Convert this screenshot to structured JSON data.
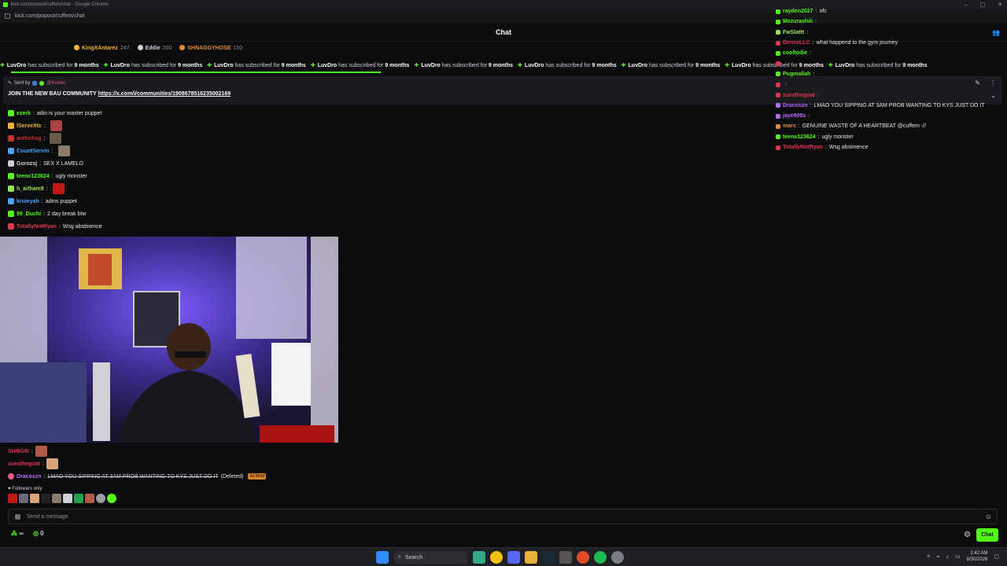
{
  "browser": {
    "title": "kick.com/popout/cuffem/chat - Google Chrome",
    "url": "kick.com/popout/cuffem/chat"
  },
  "header": {
    "title": "Chat"
  },
  "leaderboard": [
    {
      "name": "KingXAntarez",
      "value": "247",
      "color": "#f2b233"
    },
    {
      "name": "Eddie",
      "value": "200",
      "color": "#cfd1d6"
    },
    {
      "name": "SHNAGGYHOSE",
      "value": "150",
      "color": "#e28a3a"
    }
  ],
  "ticker": {
    "items": [
      {
        "user": "LuvDro",
        "text": "has subscribed for",
        "months": "9 months"
      },
      {
        "user": "LuvDro",
        "text": "has subscribed for",
        "months": "9 months"
      },
      {
        "user": "LuvDro",
        "text": "has subscribed for",
        "months": "9 months"
      },
      {
        "user": "LuvDro",
        "text": "has subscribed for",
        "months": "9 months"
      },
      {
        "user": "LuvDro",
        "text": "has subscribed for",
        "months": "9 months"
      },
      {
        "user": "LuvDro",
        "text": "has subscribed for",
        "months": "9 months"
      },
      {
        "user": "LuvDro",
        "text": "has subscribed for",
        "months": "9 months"
      },
      {
        "user": "LuvDro",
        "text": "has subscribed for",
        "months": "9 months"
      },
      {
        "user": "LuvDro",
        "text": "has subscribed for",
        "months": "9 months"
      }
    ]
  },
  "pinned": {
    "sent_by_label": "Sent by",
    "sender": "@Kickiet",
    "message": "JOIN THE NEW BAU COMMUNITY",
    "link": "https://x.com/i/communities/1908678516235002169"
  },
  "chat": [
    {
      "user": "ezerk",
      "color": "#53fc18",
      "text": "adin is your master puppet",
      "emote": ""
    },
    {
      "user": "lServeXtc",
      "color": "#f2b233",
      "text": "",
      "emote": "#a44"
    },
    {
      "user": "anthohsg",
      "color": "#c93030",
      "text": "",
      "emote": "#6a5a4a"
    },
    {
      "user": "CountServin",
      "color": "#4aa3ff",
      "text": "",
      "emote": "#8a7a6a"
    },
    {
      "user": "Gorozsj",
      "color": "#cfd1d6",
      "text": "SEX X LAMELO",
      "emote": ""
    },
    {
      "user": "teenx123624",
      "color": "#53fc18",
      "text": "ugly monster",
      "emote": ""
    },
    {
      "user": "h_aitham9",
      "color": "#9ce35a",
      "text": "",
      "emote": "#c21818"
    },
    {
      "user": "kruieyah",
      "color": "#4aa3ff",
      "text": "adins puppet",
      "emote": ""
    },
    {
      "user": "99_Duchi",
      "color": "#53fc18",
      "text": "2 day break btw",
      "emote": ""
    },
    {
      "user": "TotallyNotRyan",
      "color": "#e0364f",
      "text": "Wsg abstinence",
      "emote": ""
    }
  ],
  "chat_lower": [
    {
      "user": "SHI6G6I",
      "color": "#e0364f",
      "text": "",
      "emote": "#b05a4a"
    },
    {
      "user": "zuesthegoat",
      "color": "#e0364f",
      "text": "",
      "emote": "#d9a57a"
    },
    {
      "user": "Dracoszn",
      "color": "#b46cff",
      "text": "LMAO YOU SIPPING AT 3AM PROB WANTING TO KYS JUST DO IT",
      "deleted": "(Deleted)",
      "tag": "AI Mod"
    }
  ],
  "followers_only": "Followers only",
  "input": {
    "placeholder": "Send a message"
  },
  "bottom": {
    "count1": "∞",
    "count2": "0",
    "chat_button": "Chat"
  },
  "right_chat": [
    {
      "user": "rayden2027",
      "color": "#53fc18",
      "text": "ofc"
    },
    {
      "user": "Mezurashiii",
      "color": "#53fc18",
      "text": ""
    },
    {
      "user": "FwSlattt",
      "color": "#9ce35a",
      "text": ""
    },
    {
      "user": "DenzoLLC",
      "color": "#e0364f",
      "text": "what happend to the gym journey"
    },
    {
      "user": "cooltodie",
      "color": "#53fc18",
      "text": ""
    },
    {
      "user": "",
      "color": "#e0364f",
      "text": ""
    },
    {
      "user": "Pugmallah",
      "color": "#53fc18",
      "text": ""
    },
    {
      "user": "",
      "color": "#e0364f",
      "text": ""
    },
    {
      "user": "zuesthegoat",
      "color": "#e0364f",
      "text": ""
    },
    {
      "user": "Dracoszn",
      "color": "#b46cff",
      "text": "LMAO YOU SIPPING AT 3AM PROB WANTING TO KYS JUST DO IT"
    },
    {
      "user": "jaye808s",
      "color": "#b46cff",
      "text": ""
    },
    {
      "user": "marx",
      "color": "#e28a3a",
      "text": "GENUINE WASTE OF A HEARTBEAT @cuffem -//"
    },
    {
      "user": "teenx123624",
      "color": "#53fc18",
      "text": "ugly monster"
    },
    {
      "user": "TotallyNotRyan",
      "color": "#e0364f",
      "text": "Wsg abstinence"
    }
  ],
  "taskbar": {
    "search": "Search",
    "time": "2:42 AM",
    "date": "8/30/2026"
  }
}
